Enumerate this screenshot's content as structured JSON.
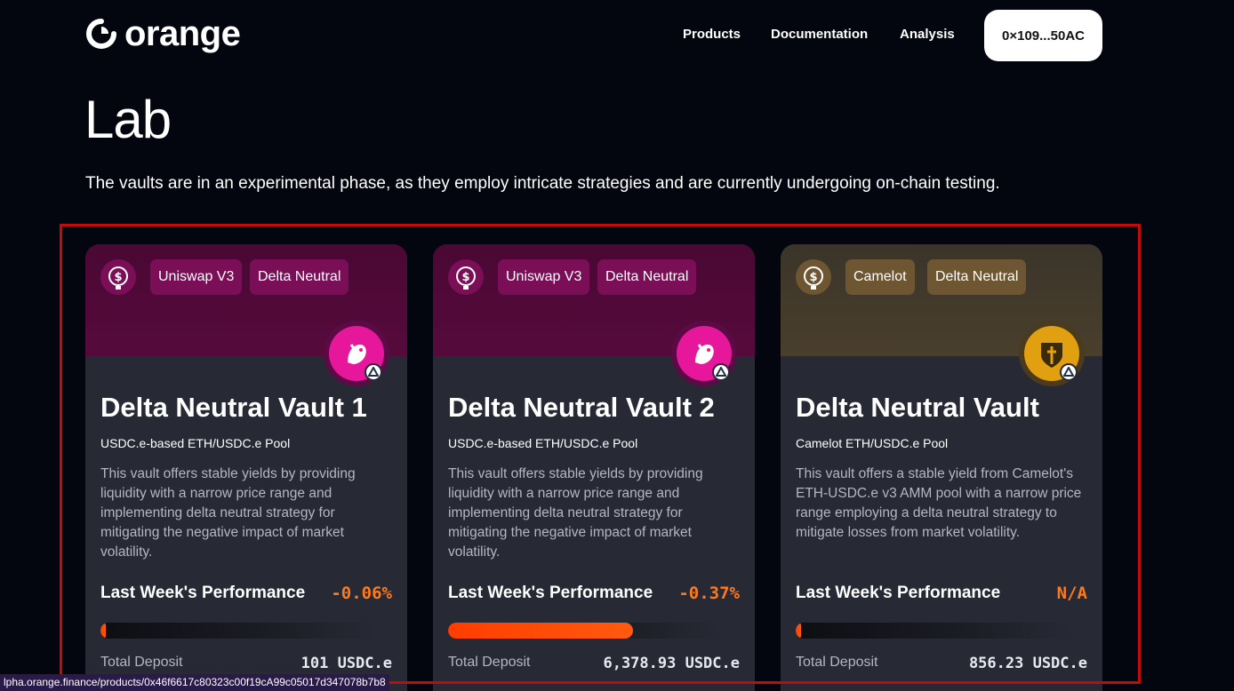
{
  "brand": {
    "name": "orange"
  },
  "nav": {
    "products": "Products",
    "documentation": "Documentation",
    "analysis": "Analysis"
  },
  "wallet": {
    "address": "0×109...50AC"
  },
  "page": {
    "title": "Lab",
    "description": "The vaults are in an experimental phase, as they employ intricate strategies and are currently undergoing on-chain testing."
  },
  "cards": [
    {
      "theme": "pink",
      "icons": {
        "token": "usdc-token-icon",
        "protocol": "uniswap-icon",
        "chain": "arbitrum-icon"
      },
      "tags": [
        "Uniswap V3",
        "Delta Neutral"
      ],
      "title": "Delta Neutral Vault 1",
      "subtitle": "USDC.e-based ETH/USDC.e Pool",
      "description": "This vault offers stable yields by providing liquidity with a narrow price range and implementing delta neutral strategy for mitigating the negative impact of market volatility.",
      "performance_label": "Last Week's Performance",
      "performance_value": "-0.06%",
      "progress": 0.01,
      "deposit_label": "Total Deposit",
      "deposit_value": "101 USDC.e"
    },
    {
      "theme": "pink",
      "icons": {
        "token": "usdc-token-icon",
        "protocol": "uniswap-icon",
        "chain": "arbitrum-icon"
      },
      "tags": [
        "Uniswap V3",
        "Delta Neutral"
      ],
      "title": "Delta Neutral Vault 2",
      "subtitle": "USDC.e-based ETH/USDC.e Pool",
      "description": "This vault offers stable yields by providing liquidity with a narrow price range and implementing delta neutral strategy for mitigating the negative impact of market volatility.",
      "performance_label": "Last Week's Performance",
      "performance_value": "-0.37%",
      "progress": 0.67,
      "deposit_label": "Total Deposit",
      "deposit_value": "6,378.93 USDC.e"
    },
    {
      "theme": "gold",
      "icons": {
        "token": "usdc-token-icon",
        "protocol": "camelot-icon",
        "chain": "arbitrum-icon"
      },
      "tags": [
        "Camelot",
        "Delta Neutral"
      ],
      "title": "Delta Neutral Vault",
      "subtitle": "Camelot ETH/USDC.e Pool",
      "description": "This vault offers a stable yield from Camelot's ETH-USDC.e v3 AMM pool with a narrow price range employing a delta neutral strategy to mitigate losses from market volatility.",
      "performance_label": "Last Week's Performance",
      "performance_value": "N/A",
      "progress": 0.01,
      "deposit_label": "Total Deposit",
      "deposit_value": "856.23 USDC.e"
    }
  ],
  "status_bar": {
    "url": "lpha.orange.finance/products/0x46f6617c80323c00f19cA99c05017d347078b7b8"
  },
  "colors": {
    "background": "#03060f",
    "accent": "#ff7a1a",
    "progress": "#ff3d00",
    "highlight_border": "#c40a0a"
  }
}
